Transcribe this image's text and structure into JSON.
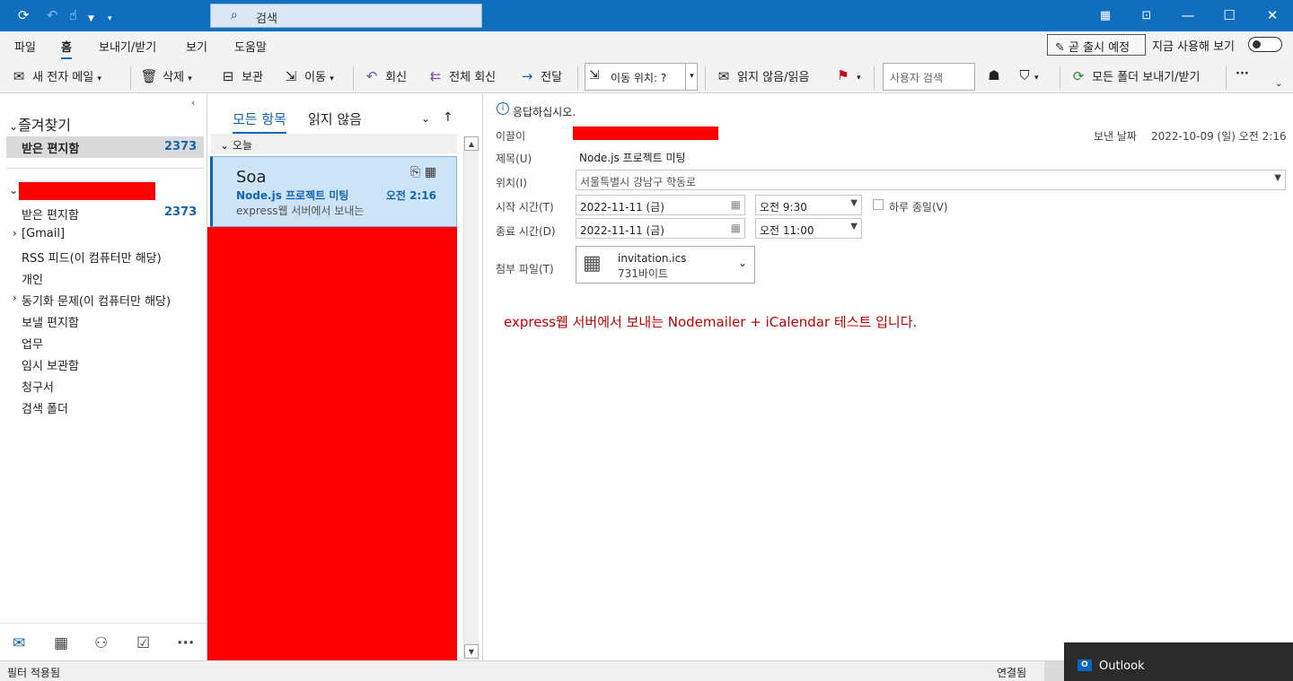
{
  "titlebar": {
    "search_placeholder": "검색"
  },
  "menu": {
    "items": [
      "파일",
      "홈",
      "보내기/받기",
      "보기",
      "도움말"
    ],
    "coming_soon": "곧 출시 예정",
    "try_now": "지금 사용해 보기"
  },
  "ribbon": {
    "new_mail": "새 전자 메일",
    "delete": "삭제",
    "archive": "보관",
    "move": "이동",
    "reply": "회신",
    "reply_all": "전체 회신",
    "forward": "전달",
    "move_to": "이동 위치: ?",
    "unread_read": "읽지 않음/읽음",
    "people_search": "사용자 검색",
    "send_receive_all": "모든 폴더 보내기/받기"
  },
  "sidebar": {
    "favorites": "즐겨찾기",
    "fav_inbox": "받은 편지함",
    "fav_inbox_count": "2373",
    "account_folders": [
      {
        "label": "받은 편지함",
        "count": "2373"
      },
      {
        "label": "[Gmail]",
        "expand": "›"
      },
      {
        "label": "RSS 피드(이 컴퓨터만 해당)"
      },
      {
        "label": "개인"
      },
      {
        "label": "동기화 문제(이 컴퓨터만 해당)",
        "expand": "›"
      },
      {
        "label": "보낼 편지함"
      },
      {
        "label": "업무"
      },
      {
        "label": "임시 보관함"
      },
      {
        "label": "청구서"
      },
      {
        "label": "검색 폴더"
      }
    ]
  },
  "list": {
    "tab_all": "모든 항목",
    "tab_unread": "읽지 않음",
    "group_today": "오늘",
    "message": {
      "sender": "Soa",
      "subject": "Node.js 프로젝트 미팅",
      "time": "오전 2:16",
      "preview": "express웹 서버에서 보내는"
    }
  },
  "reading": {
    "notice": "응답하십시오.",
    "from_label": "이끌이",
    "sent_label": "보낸 날짜",
    "sent_value": "2022-10-09 (일) 오전 2:16",
    "subject_label": "제목(U)",
    "subject_value": "Node.js 프로젝트 미팅",
    "location_label": "위치(I)",
    "location_value": "서울특별시 강남구 학동로",
    "start_label": "시작 시간(T)",
    "start_date": "2022-11-11 (금)",
    "start_time": "오전 9:30",
    "allday_label": "하루 종일(V)",
    "end_label": "종료 시간(D)",
    "end_date": "2022-11-11 (금)",
    "end_time": "오전 11:00",
    "attach_label": "첨부 파일(T)",
    "attach_name": "invitation.ics",
    "attach_size": "731바이트",
    "body": "express웹 서버에서 보내는 Nodemailer + iCalendar 테스트 입니다."
  },
  "status": {
    "filter": "필터 적용됨",
    "connected": "연결됨"
  },
  "toast": {
    "app": "Outlook"
  },
  "colors": {
    "accent": "#106ebe",
    "link": "#1065b4",
    "body_text": "#c00000",
    "redaction": "#ff0000"
  }
}
